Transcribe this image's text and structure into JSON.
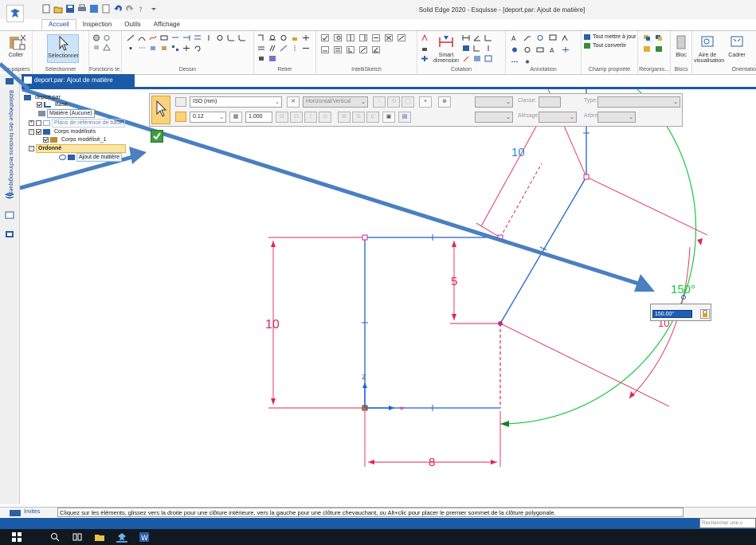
{
  "window": {
    "title": "Solid Edge 2020 - Esquisse - [deport.par: Ajout de matière]"
  },
  "ribbon": {
    "tabs": [
      "Accueil",
      "Inspection",
      "Outils",
      "Affichage"
    ],
    "active_tab": "Accueil",
    "groups": {
      "clipboard": {
        "label": "...e-papiers",
        "paste": "Coller"
      },
      "select": {
        "label": "Sélectionner",
        "button": "Sélectionner"
      },
      "features": {
        "label": "Fonctions te..."
      },
      "draw": {
        "label": "Dessin"
      },
      "relate": {
        "label": "Relier"
      },
      "intellisketch": {
        "label": "IntelliSketch"
      },
      "dimension": {
        "label": "Cotation",
        "smart_dimension_1": "Smart",
        "smart_dimension_2": "dimension"
      },
      "annotation": {
        "label": "Annotation"
      },
      "property": {
        "label": "Champ propriété",
        "update_all": "Tout mettre à jour",
        "convert_all": "Tout convertir"
      },
      "rearrange": {
        "label": "Réorganis..."
      },
      "blocks": {
        "label": "Blocs",
        "block": "Bloc"
      },
      "orient": {
        "label": "Orientatio",
        "view_area_1": "Aire de",
        "view_area_2": "visualisation",
        "frame": "Cadrer"
      }
    }
  },
  "side": {
    "library_label": "Bibliothèque des fonctions technologiques"
  },
  "document_tab": {
    "label": "deport.par: Ajout de matière"
  },
  "tree": {
    "items": [
      {
        "label": "deport.par"
      },
      {
        "label": "Base"
      },
      {
        "label": "Matière (Aucune)"
      },
      {
        "label": "Plans de référence de base"
      },
      {
        "label": "Corps modélisés"
      },
      {
        "label": "Corps modélisé_1"
      },
      {
        "label": "Ordonné"
      },
      {
        "label": "Ajout de matière"
      }
    ]
  },
  "command_bar": {
    "standard": "ISO (mm)",
    "orientation": "Horizontal/Vertical",
    "classe_label": "Classe:",
    "type_label": "Type:",
    "alesage_label": "Alésage:",
    "arbre_label": "Arbre:",
    "line_width": "0.12",
    "scale": "1.000",
    "close_symbol": "×",
    "close_circle_symbol": "⊗"
  },
  "sketch": {
    "dim_top": "10",
    "dim_left": "10",
    "dim_mid": "5",
    "dim_bottom": "8",
    "angle": "150°",
    "angle_partial": "10",
    "axis_z": "Z",
    "value_input": "150.00°"
  },
  "prompt": {
    "label": "Invites",
    "text": "Cliquez sur les éléments, glissez vers la droite pour une clôture intérieure, vers la gauche pour une clôture chevauchant, ou Alt+clic pour placer le premier sommet de la clôture polygonale."
  },
  "status": {
    "search_placeholder": "Rechercher une c"
  },
  "colors": {
    "sketch_blue": "#1f5fd4",
    "dimension_red": "#e0245a",
    "arc_green": "#18c840",
    "annotation_arrow": "#4a7fc0",
    "tab_blue": "#1b5aa6"
  }
}
